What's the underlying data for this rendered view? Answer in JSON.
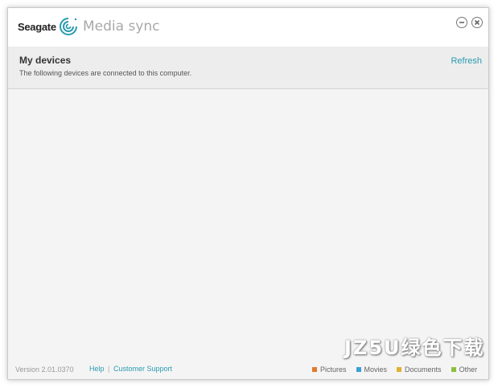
{
  "app": {
    "brand": "Seagate",
    "title": "Media sync"
  },
  "header": {
    "title": "My devices",
    "subtitle": "The following devices are connected to this computer.",
    "refresh_label": "Refresh"
  },
  "footer": {
    "version": "Version 2.01.0370",
    "help_label": "Help",
    "separator": "|",
    "support_label": "Customer Support",
    "legend": [
      {
        "label": "Pictures",
        "color": "#e07a2c"
      },
      {
        "label": "Movies",
        "color": "#3aa0d8"
      },
      {
        "label": "Documents",
        "color": "#e0b030"
      },
      {
        "label": "Other",
        "color": "#8cbf3c"
      }
    ]
  },
  "watermark": "JZ5U绿色下载",
  "icons": {
    "minimize": "minimize-icon",
    "close": "close-icon",
    "logo": "seagate-logo-icon"
  }
}
